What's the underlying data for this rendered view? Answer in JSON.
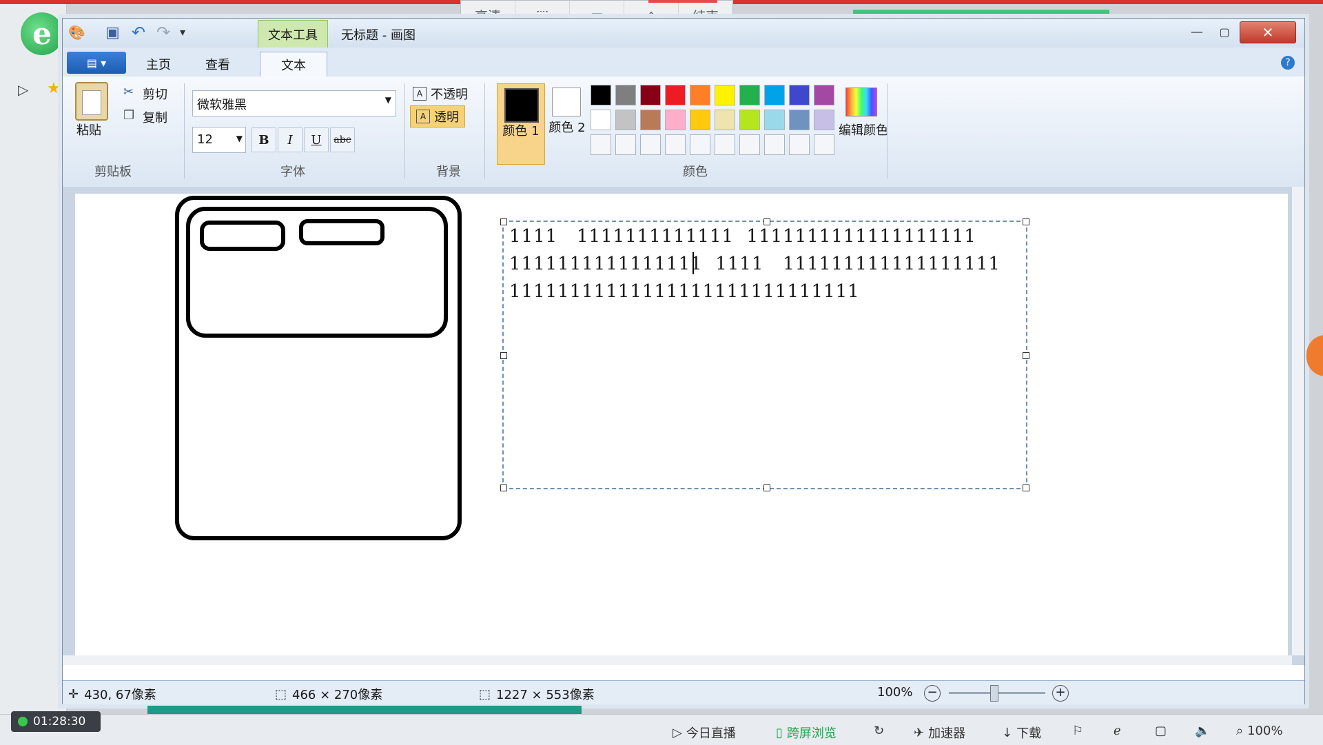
{
  "browser": {
    "logo": "e",
    "remote_toolbar": [
      "高清",
      "⬚",
      "▭",
      "⌂",
      "结束"
    ]
  },
  "window": {
    "context_tab": "文本工具",
    "title": "无标题 - 画图",
    "controls": {
      "minimize": "—",
      "maximize": "▢",
      "close": "✕"
    }
  },
  "tabs": {
    "file": "▤ ▾",
    "home": "主页",
    "view": "查看",
    "text": "文本"
  },
  "ribbon": {
    "clipboard": {
      "paste": "粘贴",
      "cut": "剪切",
      "copy": "复制",
      "group": "剪贴板"
    },
    "font": {
      "family": "微软雅黑",
      "size": "12",
      "bold": "B",
      "italic": "I",
      "underline": "U",
      "strike": "abc",
      "group": "字体"
    },
    "background": {
      "opaque": "不透明",
      "transparent": "透明",
      "group": "背景"
    },
    "colors": {
      "color1": "颜色 1",
      "color2": "颜色 2",
      "edit": "编辑颜色",
      "group": "颜色",
      "row1": [
        "#000000",
        "#7f7f7f",
        "#880015",
        "#ed1c24",
        "#ff7f27",
        "#fff200",
        "#22b14c",
        "#00a2e8",
        "#3f48cc",
        "#a349a4"
      ],
      "row2": [
        "#ffffff",
        "#c3c3c3",
        "#b97a57",
        "#ffaec9",
        "#ffc90e",
        "#efe4b0",
        "#b5e61d",
        "#99d9ea",
        "#7092be",
        "#c8bfe7"
      ],
      "row3": [
        "#f4f6f9",
        "#f4f6f9",
        "#f4f6f9",
        "#f4f6f9",
        "#f4f6f9",
        "#f4f6f9",
        "#f4f6f9",
        "#f4f6f9",
        "#f4f6f9",
        "#f4f6f9"
      ]
    }
  },
  "canvas_text": {
    "line1": "1111   1111111111111  1111111111111111111",
    "line2": "1111111111111111  1111   111111111111111111",
    "line3": "11111111111111111111111111111"
  },
  "status": {
    "cursor": "430, 67像素",
    "selection": "466 × 270像素",
    "canvas_size": "1227 × 553像素",
    "zoom": "100%"
  },
  "taskbar": {
    "timer": "01:28:30",
    "live": "今日直播",
    "cross_screen": "跨屏浏览",
    "accelerator": "加速器",
    "download": "下载",
    "zoom": "100%"
  }
}
